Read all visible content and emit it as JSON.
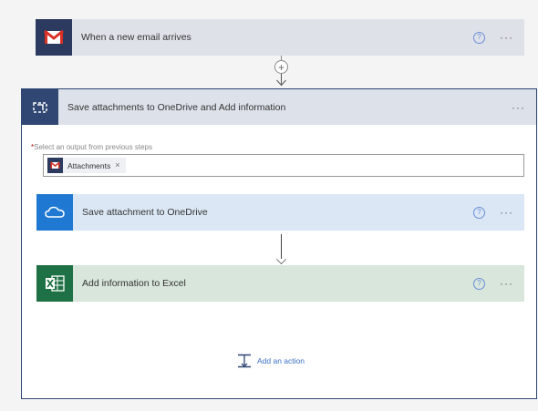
{
  "trigger": {
    "title": "When a new email arrives",
    "icon": "mail-icon",
    "help_glyph": "?",
    "more_glyph": "···"
  },
  "insert_step": {
    "glyph": "+"
  },
  "scope": {
    "title": "Save attachments to OneDrive and Add information",
    "icon": "scope-icon",
    "more_glyph": "···",
    "field": {
      "required_mark": "*",
      "label": "Select an output from previous steps",
      "token": {
        "label": "Attachments",
        "close_glyph": "×",
        "icon": "mail-icon"
      }
    },
    "actions": [
      {
        "title": "Save attachment to OneDrive",
        "icon": "onedrive-icon",
        "help_glyph": "?",
        "more_glyph": "···"
      },
      {
        "title": "Add information to Excel",
        "icon": "excel-icon",
        "help_glyph": "?",
        "more_glyph": "···"
      }
    ],
    "add_action": {
      "label": "Add an action",
      "icon": "add-action-icon"
    }
  },
  "colors": {
    "trigger_bg": "#dfe1e9",
    "scope_border": "#2f4772",
    "onedrive_bg": "#dbe7f5",
    "excel_bg": "#d8e6dc",
    "link": "#3a6fc4"
  }
}
